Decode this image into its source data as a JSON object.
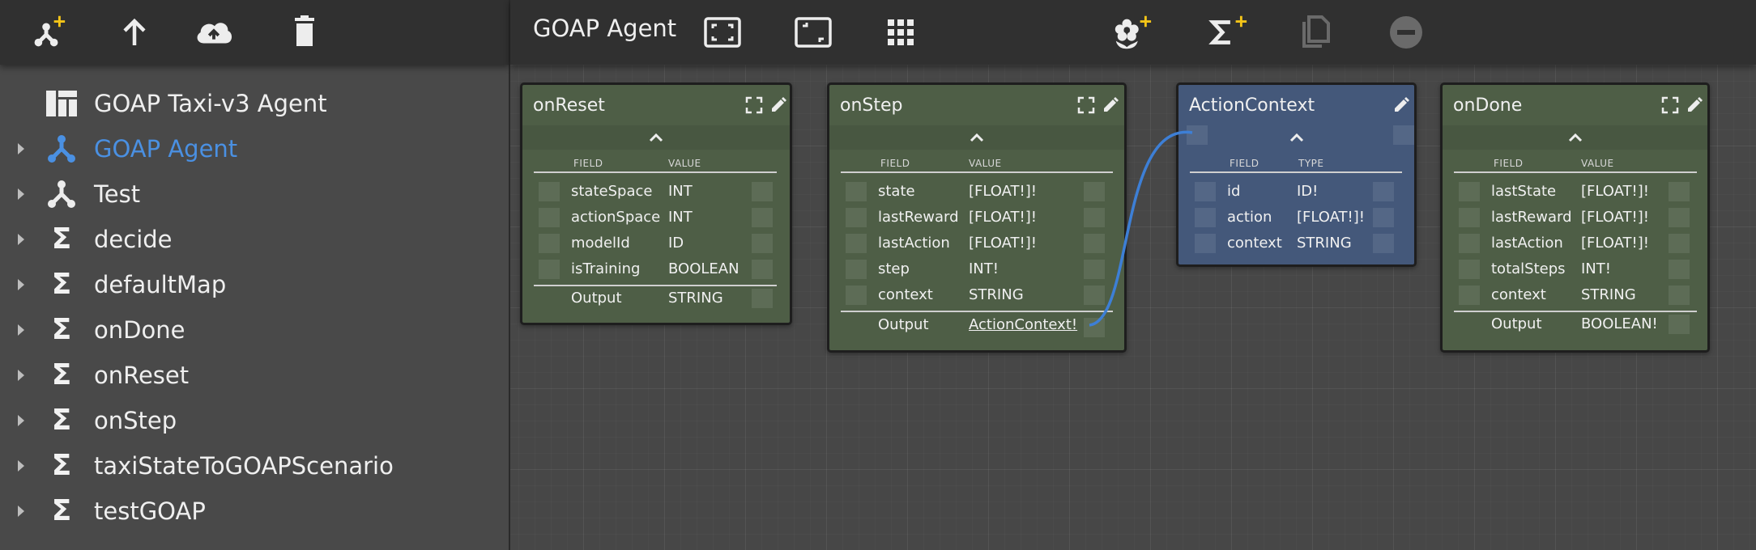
{
  "left_toolbar": {
    "icons": [
      "add-agent-icon",
      "upload-icon",
      "cloud-upload-icon",
      "trash-icon"
    ],
    "accent": "#f5c518"
  },
  "tree": {
    "items": [
      {
        "label": "GOAP Taxi-v3 Agent",
        "icon": "dashboard-icon",
        "caret": false
      },
      {
        "label": "GOAP Agent",
        "icon": "agent-icon",
        "caret": true,
        "active": true
      },
      {
        "label": "Test",
        "icon": "agent-icon",
        "caret": true
      },
      {
        "label": "decide",
        "icon": "sigma-icon",
        "caret": true
      },
      {
        "label": "defaultMap",
        "icon": "sigma-icon",
        "caret": true
      },
      {
        "label": "onDone",
        "icon": "sigma-icon",
        "caret": true
      },
      {
        "label": "onReset",
        "icon": "sigma-icon",
        "caret": true
      },
      {
        "label": "onStep",
        "icon": "sigma-icon",
        "caret": true
      },
      {
        "label": "taxiStateToGOAPScenario",
        "icon": "sigma-icon",
        "caret": true
      },
      {
        "label": "testGOAP",
        "icon": "sigma-icon",
        "caret": true
      }
    ],
    "sigma_glyph": "Σ",
    "active_color": "#4a90e2"
  },
  "canvas_toolbar": {
    "title": "GOAP Agent",
    "icons": [
      "fit-screen-icon",
      "fullscreen-exit-icon",
      "grid-icon",
      "add-flower-icon",
      "add-function-icon",
      "copy-icon",
      "remove-icon"
    ]
  },
  "nodes": {
    "onReset": {
      "title": "onReset",
      "col1": "FIELD",
      "col2": "VALUE",
      "fields": [
        {
          "name": "stateSpace",
          "value": "INT"
        },
        {
          "name": "actionSpace",
          "value": "INT"
        },
        {
          "name": "modelId",
          "value": "ID"
        },
        {
          "name": "isTraining",
          "value": "BOOLEAN"
        }
      ],
      "output_label": "Output",
      "output_value": "STRING"
    },
    "onStep": {
      "title": "onStep",
      "col1": "FIELD",
      "col2": "VALUE",
      "fields": [
        {
          "name": "state",
          "value": "[FLOAT!]!"
        },
        {
          "name": "lastReward",
          "value": "[FLOAT!]!"
        },
        {
          "name": "lastAction",
          "value": "[FLOAT!]!"
        },
        {
          "name": "step",
          "value": "INT!"
        },
        {
          "name": "context",
          "value": "STRING"
        }
      ],
      "output_label": "Output",
      "output_value": "ActionContext!"
    },
    "actionContext": {
      "title": "ActionContext",
      "col1": "FIELD",
      "col2": "TYPE",
      "fields": [
        {
          "name": "id",
          "value": "ID!"
        },
        {
          "name": "action",
          "value": "[FLOAT!]!"
        },
        {
          "name": "context",
          "value": "STRING"
        }
      ]
    },
    "onDone": {
      "title": "onDone",
      "col1": "FIELD",
      "col2": "VALUE",
      "fields": [
        {
          "name": "lastState",
          "value": "[FLOAT!]!"
        },
        {
          "name": "lastReward",
          "value": "[FLOAT!]!"
        },
        {
          "name": "lastAction",
          "value": "[FLOAT!]!"
        },
        {
          "name": "totalSteps",
          "value": "INT!"
        },
        {
          "name": "context",
          "value": "STRING"
        }
      ],
      "output_label": "Output",
      "output_value": "BOOLEAN!"
    }
  },
  "colors": {
    "node_green": "#4e5e46",
    "node_blue": "#44587a",
    "wire": "#3d7fd6",
    "toolbar": "#303030",
    "panel": "#494949"
  }
}
